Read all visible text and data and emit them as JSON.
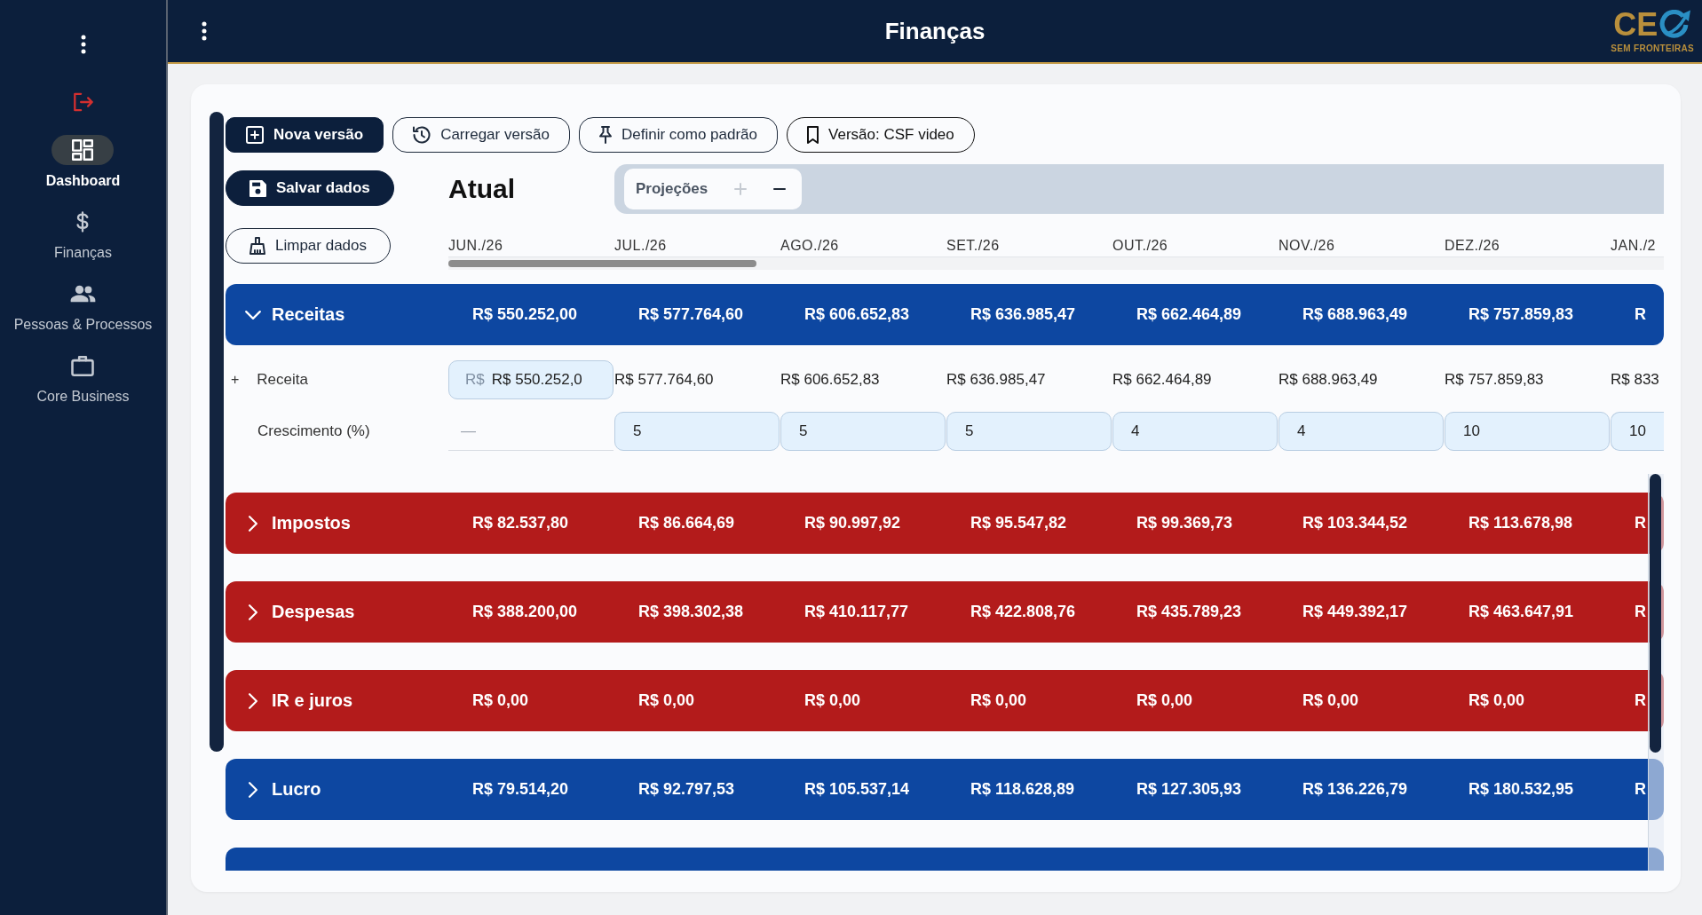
{
  "sidebar": {
    "items": [
      {
        "label": "Dashboard",
        "selected": true
      },
      {
        "label": "Finanças",
        "selected": false
      },
      {
        "label": "Pessoas & Processos",
        "selected": false
      },
      {
        "label": "Core Business",
        "selected": false
      }
    ]
  },
  "top_bar": {
    "title": "Finanças",
    "logo": {
      "mark": "CE",
      "tagline": "SEM FRONTEIRAS"
    }
  },
  "toolbar": {
    "buttons": [
      {
        "label": "Nova versão",
        "kind": "filled"
      },
      {
        "label": "Carregar versão",
        "kind": "outlined"
      },
      {
        "label": "Definir como padrão",
        "kind": "outlined"
      },
      {
        "label": "Versão: CSF video",
        "kind": "chip"
      }
    ]
  },
  "actions": [
    {
      "label": "Salvar dados",
      "kind": "filled"
    },
    {
      "label": "Limpar dados",
      "kind": "outlined"
    }
  ],
  "view": {
    "title": "Atual"
  },
  "projections": {
    "label": "Projeções",
    "add_button": {
      "disabled": true
    },
    "remove_button": {
      "disabled": false
    }
  },
  "months": [
    "JUN./26",
    "JUL./26",
    "AGO./26",
    "SET./26",
    "OUT./26",
    "NOV./26",
    "DEZ./26",
    "JAN./2"
  ],
  "groups": [
    {
      "label": "Receitas",
      "color": "#0d47a1",
      "expanded": true,
      "totals": [
        "R$ 550.252,00",
        "R$ 577.764,60",
        "R$ 606.652,83",
        "R$ 636.985,47",
        "R$ 662.464,89",
        "R$ 688.963,49",
        "R$ 757.859,83",
        "R"
      ],
      "rows": [
        {
          "toggle": "+",
          "label": "Receita",
          "cells": [
            {
              "kind": "input",
              "prefix": "R$",
              "value": "R$ 550.252,0"
            },
            {
              "kind": "text",
              "value": "R$ 577.764,60"
            },
            {
              "kind": "text",
              "value": "R$ 606.652,83"
            },
            {
              "kind": "text",
              "value": "R$ 636.985,47"
            },
            {
              "kind": "text",
              "value": "R$ 662.464,89"
            },
            {
              "kind": "text",
              "value": "R$ 688.963,49"
            },
            {
              "kind": "text",
              "value": "R$ 757.859,83"
            },
            {
              "kind": "text",
              "value": "R$ 833"
            }
          ]
        },
        {
          "label": "Crescimento (%)",
          "cells": [
            {
              "kind": "readonly",
              "value": "—"
            },
            {
              "kind": "input",
              "value": "5"
            },
            {
              "kind": "input",
              "value": "5"
            },
            {
              "kind": "input",
              "value": "5"
            },
            {
              "kind": "input",
              "value": "4"
            },
            {
              "kind": "input",
              "value": "4"
            },
            {
              "kind": "input",
              "value": "10"
            },
            {
              "kind": "input",
              "value": "10"
            }
          ]
        }
      ]
    },
    {
      "label": "Impostos",
      "color": "#b31b1b",
      "expanded": false,
      "totals": [
        "R$ 82.537,80",
        "R$ 86.664,69",
        "R$ 90.997,92",
        "R$ 95.547,82",
        "R$ 99.369,73",
        "R$ 103.344,52",
        "R$ 113.678,98",
        "R"
      ]
    },
    {
      "label": "Despesas",
      "color": "#b31b1b",
      "expanded": false,
      "totals": [
        "R$ 388.200,00",
        "R$ 398.302,38",
        "R$ 410.117,77",
        "R$ 422.808,76",
        "R$ 435.789,23",
        "R$ 449.392,17",
        "R$ 463.647,91",
        "R"
      ]
    },
    {
      "label": "IR e juros",
      "color": "#b31b1b",
      "expanded": false,
      "totals": [
        "R$ 0,00",
        "R$ 0,00",
        "R$ 0,00",
        "R$ 0,00",
        "R$ 0,00",
        "R$ 0,00",
        "R$ 0,00",
        "R"
      ]
    },
    {
      "label": "Lucro",
      "color": "#0d47a1",
      "expanded": false,
      "totals": [
        "R$ 79.514,20",
        "R$ 92.797,53",
        "R$ 105.537,14",
        "R$ 118.628,89",
        "R$ 127.305,93",
        "R$ 136.226,79",
        "R$ 180.532,95",
        "R"
      ]
    },
    {
      "color": "#0d47a1"
    }
  ]
}
